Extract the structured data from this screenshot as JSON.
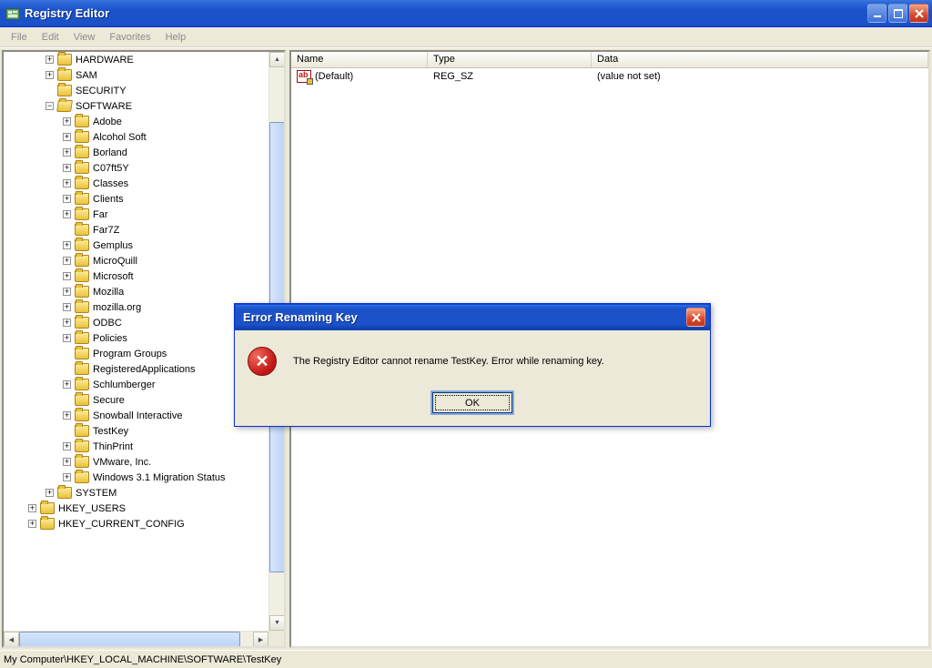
{
  "titlebar": {
    "title": "Registry Editor"
  },
  "menubar": {
    "file": "File",
    "edit": "Edit",
    "view": "View",
    "favorites": "Favorites",
    "help": "Help"
  },
  "tree": {
    "items": [
      {
        "depth": 2,
        "expander": "+",
        "open": false,
        "label": "HARDWARE"
      },
      {
        "depth": 2,
        "expander": "+",
        "open": false,
        "label": "SAM"
      },
      {
        "depth": 2,
        "expander": "",
        "open": false,
        "label": "SECURITY"
      },
      {
        "depth": 2,
        "expander": "-",
        "open": true,
        "label": "SOFTWARE"
      },
      {
        "depth": 3,
        "expander": "+",
        "open": false,
        "label": "Adobe"
      },
      {
        "depth": 3,
        "expander": "+",
        "open": false,
        "label": "Alcohol Soft"
      },
      {
        "depth": 3,
        "expander": "+",
        "open": false,
        "label": "Borland"
      },
      {
        "depth": 3,
        "expander": "+",
        "open": false,
        "label": "C07ft5Y"
      },
      {
        "depth": 3,
        "expander": "+",
        "open": false,
        "label": "Classes"
      },
      {
        "depth": 3,
        "expander": "+",
        "open": false,
        "label": "Clients"
      },
      {
        "depth": 3,
        "expander": "+",
        "open": false,
        "label": "Far"
      },
      {
        "depth": 3,
        "expander": "",
        "open": false,
        "label": "Far7Z"
      },
      {
        "depth": 3,
        "expander": "+",
        "open": false,
        "label": "Gemplus"
      },
      {
        "depth": 3,
        "expander": "+",
        "open": false,
        "label": "MicroQuill"
      },
      {
        "depth": 3,
        "expander": "+",
        "open": false,
        "label": "Microsoft"
      },
      {
        "depth": 3,
        "expander": "+",
        "open": false,
        "label": "Mozilla"
      },
      {
        "depth": 3,
        "expander": "+",
        "open": false,
        "label": "mozilla.org"
      },
      {
        "depth": 3,
        "expander": "+",
        "open": false,
        "label": "ODBC"
      },
      {
        "depth": 3,
        "expander": "+",
        "open": false,
        "label": "Policies"
      },
      {
        "depth": 3,
        "expander": "",
        "open": false,
        "label": "Program Groups"
      },
      {
        "depth": 3,
        "expander": "",
        "open": false,
        "label": "RegisteredApplications"
      },
      {
        "depth": 3,
        "expander": "+",
        "open": false,
        "label": "Schlumberger"
      },
      {
        "depth": 3,
        "expander": "",
        "open": false,
        "label": "Secure"
      },
      {
        "depth": 3,
        "expander": "+",
        "open": false,
        "label": "Snowball Interactive"
      },
      {
        "depth": 3,
        "expander": "",
        "open": false,
        "label": "TestKey"
      },
      {
        "depth": 3,
        "expander": "+",
        "open": false,
        "label": "ThinPrint"
      },
      {
        "depth": 3,
        "expander": "+",
        "open": false,
        "label": "VMware, Inc."
      },
      {
        "depth": 3,
        "expander": "+",
        "open": false,
        "label": "Windows 3.1 Migration Status"
      },
      {
        "depth": 2,
        "expander": "+",
        "open": false,
        "label": "SYSTEM"
      },
      {
        "depth": 1,
        "expander": "+",
        "open": false,
        "label": "HKEY_USERS"
      },
      {
        "depth": 1,
        "expander": "+",
        "open": false,
        "label": "HKEY_CURRENT_CONFIG"
      }
    ]
  },
  "list": {
    "columns": {
      "name": "Name",
      "type": "Type",
      "data": "Data"
    },
    "col_widths": {
      "name": 150,
      "type": 180,
      "data_rest": true
    },
    "rows": [
      {
        "name": "(Default)",
        "type": "REG_SZ",
        "data": "(value not set)"
      }
    ]
  },
  "statusbar": {
    "path": "My Computer\\HKEY_LOCAL_MACHINE\\SOFTWARE\\TestKey"
  },
  "dialog": {
    "title": "Error Renaming Key",
    "message": "The Registry Editor cannot rename TestKey. Error while renaming key.",
    "ok": "OK"
  }
}
